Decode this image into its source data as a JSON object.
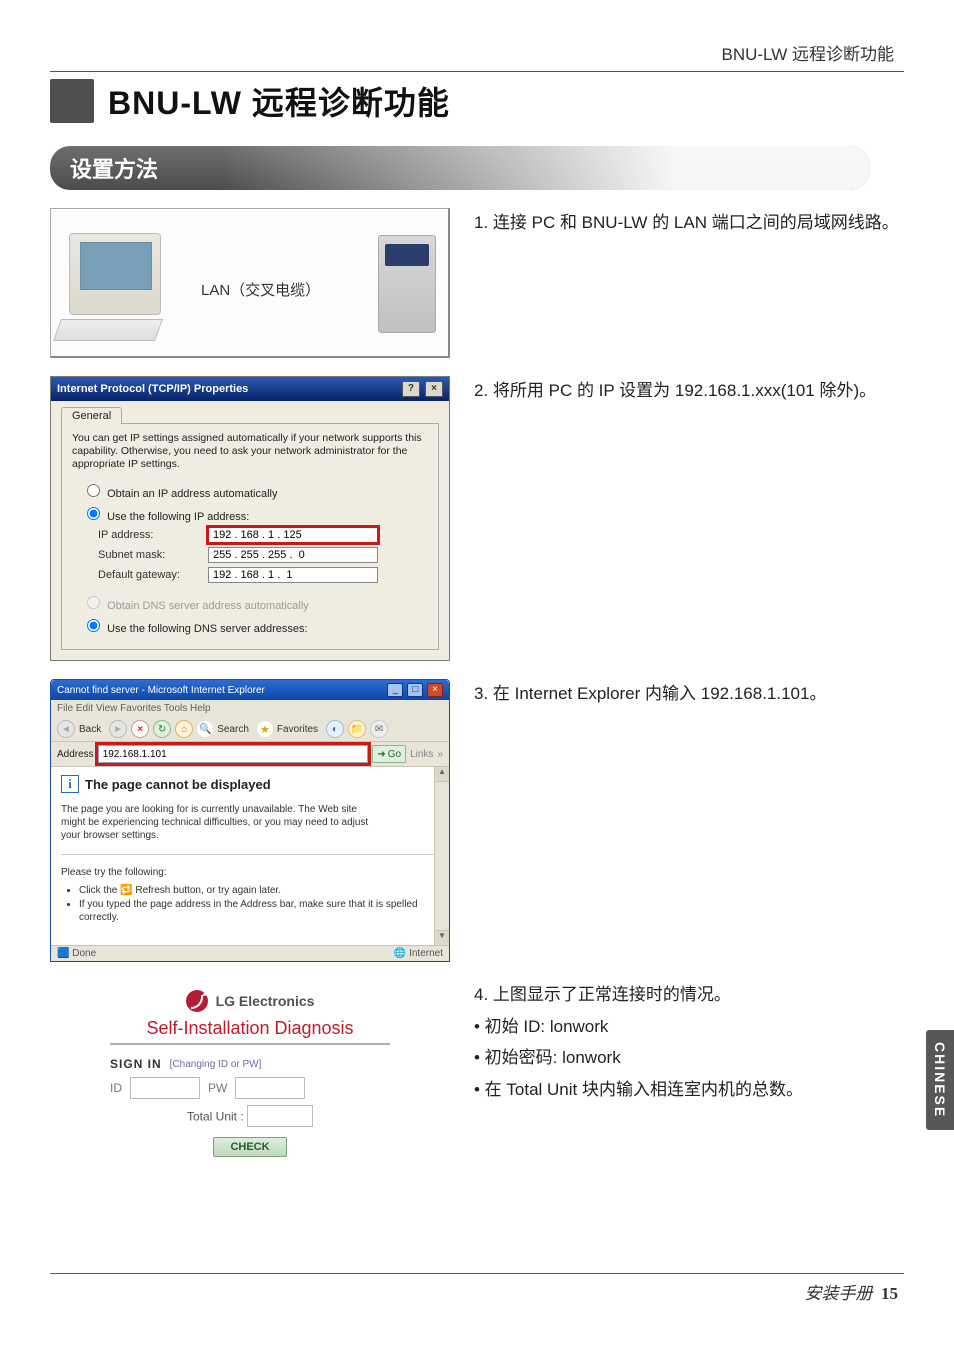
{
  "pre_header": "BNU-LW 远程诊断功能",
  "title": "BNU-LW 远程诊断功能",
  "section": "设置方法",
  "side_tab": "CHINESE",
  "footer_label": "安装手册",
  "footer_page": "15",
  "step1": {
    "text": "1. 连接 PC 和 BNU-LW 的 LAN 端口之间的局域网线路。",
    "lan_label": "LAN（交叉电缆）"
  },
  "step2": {
    "text": "2. 将所用 PC 的 IP 设置为 192.168.1.xxx(101 除外)。",
    "dlg_title": "Internet Protocol (TCP/IP) Properties",
    "tab": "General",
    "desc": "You can get IP settings assigned automatically if your network supports this capability. Otherwise, you need to ask your network administrator for the appropriate IP settings.",
    "opt_auto_ip": "Obtain an IP address automatically",
    "opt_use_ip": "Use the following IP address:",
    "lbl_ip": "IP address:",
    "val_ip": "192 . 168 . 1 . 125",
    "lbl_mask": "Subnet mask:",
    "val_mask": "255 . 255 . 255 .  0",
    "lbl_gw": "Default gateway:",
    "val_gw": "192 . 168 . 1 .  1",
    "opt_auto_dns": "Obtain DNS server address automatically",
    "opt_use_dns": "Use the following DNS server addresses:",
    "help_btn": "?",
    "close_btn": "×"
  },
  "step3": {
    "text": "3. 在 Internet Explorer 内输入 192.168.1.101。",
    "ie_title": "Cannot find server - Microsoft Internet Explorer",
    "menu": "File   Edit   View   Favorites   Tools   Help",
    "back": "Back",
    "search": "Search",
    "favorites": "Favorites",
    "addr_label": "Address",
    "addr_value": "192.168.1.101",
    "go": "Go",
    "links": "Links",
    "heading": "The page cannot be displayed",
    "body1": "The page you are looking for is currently unavailable. The Web site might be experiencing technical difficulties, or you may need to adjust your browser settings.",
    "try": "Please try the following:",
    "li1": "Click the 🔁 Refresh button, or try again later.",
    "li2": "If you typed the page address in the Address bar, make sure that it is spelled correctly.",
    "status_done": "Done",
    "status_zone": "Internet"
  },
  "step4": {
    "text": "4. 上图显示了正常连接时的情况。",
    "b1": "• 初始 ID: lonwork",
    "b2": "• 初始密码: lonwork",
    "b3": "• 在 Total Unit 块内输入相连室内机的总数。",
    "lg_brand": "LG Electronics",
    "lg_sub": "Self-Installation Diagnosis",
    "signin": "SIGN IN",
    "change": "[Changing ID or PW]",
    "id": "ID",
    "pw": "PW",
    "total": "Total Unit :",
    "check": "CHECK"
  }
}
